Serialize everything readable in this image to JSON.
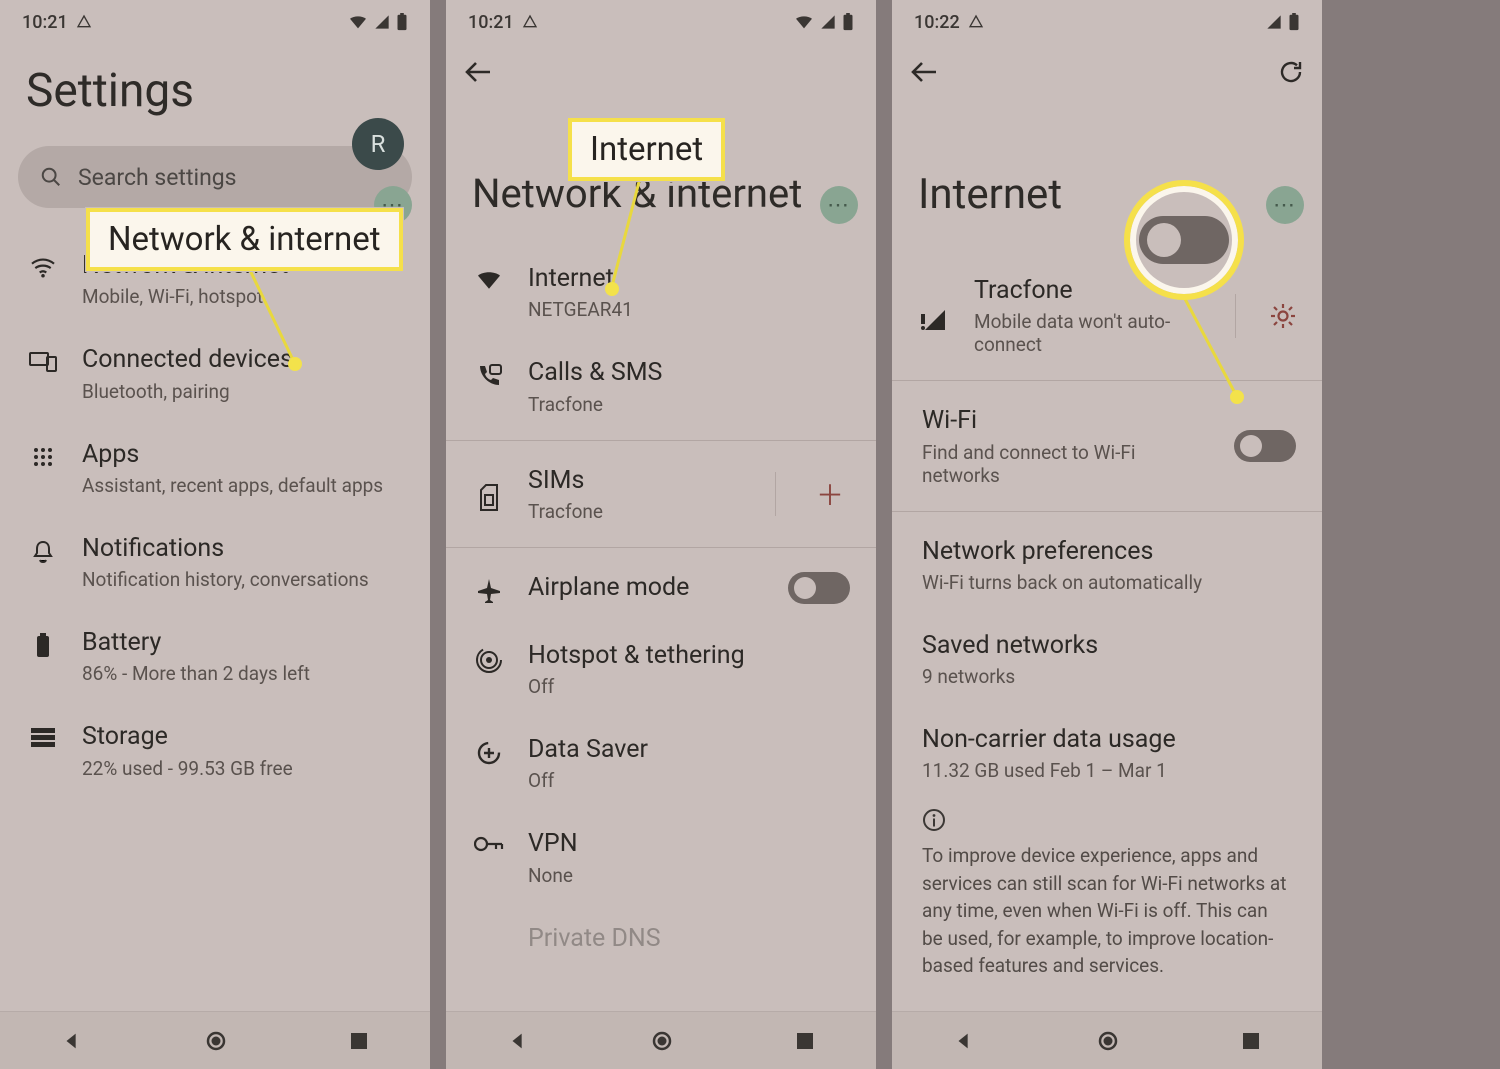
{
  "status": {
    "time1": "10:21",
    "time2": "10:21",
    "time3": "10:22"
  },
  "screen1": {
    "title": "Settings",
    "avatar_letter": "R",
    "search_placeholder": "Search settings",
    "callout": "Network & internet",
    "items": [
      {
        "title": "Network & internet",
        "sub": "Mobile, Wi-Fi, hotspot"
      },
      {
        "title": "Connected devices",
        "sub": "Bluetooth, pairing"
      },
      {
        "title": "Apps",
        "sub": "Assistant, recent apps, default apps"
      },
      {
        "title": "Notifications",
        "sub": "Notification history, conversations"
      },
      {
        "title": "Battery",
        "sub": "86% - More than 2 days left"
      },
      {
        "title": "Storage",
        "sub": "22% used - 99.53 GB free"
      }
    ]
  },
  "screen2": {
    "title": "Network & internet",
    "callout": "Internet",
    "items": [
      {
        "title": "Internet",
        "sub": "NETGEAR41"
      },
      {
        "title": "Calls & SMS",
        "sub": "Tracfone"
      },
      {
        "title": "SIMs",
        "sub": "Tracfone"
      },
      {
        "title": "Airplane mode",
        "sub": ""
      },
      {
        "title": "Hotspot & tethering",
        "sub": "Off"
      },
      {
        "title": "Data Saver",
        "sub": "Off"
      },
      {
        "title": "VPN",
        "sub": "None"
      },
      {
        "title": "Private DNS",
        "sub": ""
      }
    ]
  },
  "screen3": {
    "title": "Internet",
    "carrier": {
      "title": "Tracfone",
      "sub": "Mobile data won't auto-connect"
    },
    "wifi": {
      "title": "Wi-Fi",
      "sub": "Find and connect to Wi-Fi networks"
    },
    "netpref": {
      "title": "Network preferences",
      "sub": "Wi-Fi turns back on automatically"
    },
    "saved": {
      "title": "Saved networks",
      "sub": "9 networks"
    },
    "usage": {
      "title": "Non-carrier data usage",
      "sub": "11.32 GB used Feb 1 – Mar 1"
    },
    "info_text": "To improve device experience, apps and services can still scan for Wi-Fi networks at any time, even when Wi-Fi is off. This can be used, for example, to improve location-based features and services."
  }
}
